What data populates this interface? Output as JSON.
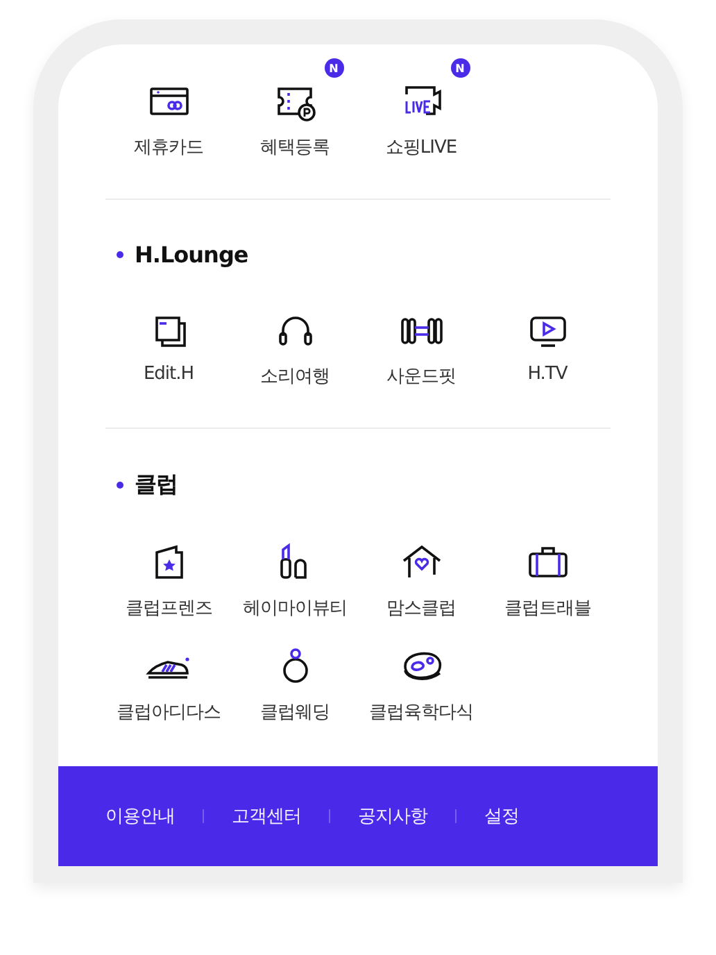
{
  "shortcuts": [
    {
      "label": "제휴카드"
    },
    {
      "label": "혜택등록",
      "badge": "N"
    },
    {
      "label": "쇼핑LIVE",
      "badge": "N"
    }
  ],
  "sections": [
    {
      "title": "H.Lounge",
      "items": [
        {
          "label": "Edit.H"
        },
        {
          "label": "소리여행"
        },
        {
          "label": "사운드핏"
        },
        {
          "label": "H.TV"
        }
      ]
    },
    {
      "title": "클럽",
      "items": [
        {
          "label": "클럽프렌즈"
        },
        {
          "label": "헤이마이뷰티"
        },
        {
          "label": "맘스클럽"
        },
        {
          "label": "클럽트래블"
        },
        {
          "label": "클럽아디다스"
        },
        {
          "label": "클럽웨딩"
        },
        {
          "label": "클럽육학다식"
        }
      ]
    }
  ],
  "footer": [
    "이용안내",
    "고객센터",
    "공지사항",
    "설정"
  ]
}
